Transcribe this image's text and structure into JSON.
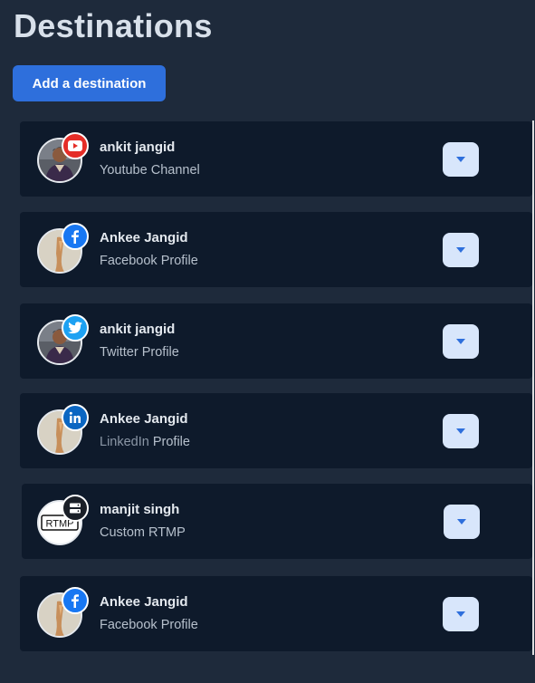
{
  "page": {
    "title": "Destinations",
    "add_button": "Add a destination"
  },
  "colors": {
    "background": "#1e2a3b",
    "card": "#0e1a2b",
    "accent": "#2e6fdc",
    "youtube": "#e52d27",
    "facebook": "#1877f2",
    "twitter": "#1da1f2",
    "linkedin": "#0a66c2"
  },
  "destinations": [
    {
      "name": "ankit jangid",
      "platform": "Youtube Channel",
      "badge_icon": "youtube-icon",
      "avatar": "photo-man"
    },
    {
      "name": "Ankee Jangid",
      "platform": "Facebook Profile",
      "badge_icon": "facebook-icon",
      "avatar": "photo-beige"
    },
    {
      "name": "ankit jangid",
      "platform": "Twitter Profile",
      "badge_icon": "twitter-icon",
      "avatar": "photo-man"
    },
    {
      "name": "Ankee Jangid",
      "platform_prefix": "LinkedIn",
      "platform_suffix": "Profile",
      "badge_icon": "linkedin-icon",
      "avatar": "photo-beige"
    },
    {
      "name": "manjit singh",
      "platform": "Custom RTMP",
      "badge_icon": "server-icon",
      "avatar": "rtmp-logo",
      "avatar_text": "RTMP"
    },
    {
      "name": "Ankee Jangid",
      "platform": "Facebook Profile",
      "badge_icon": "facebook-icon",
      "avatar": "photo-beige"
    }
  ]
}
